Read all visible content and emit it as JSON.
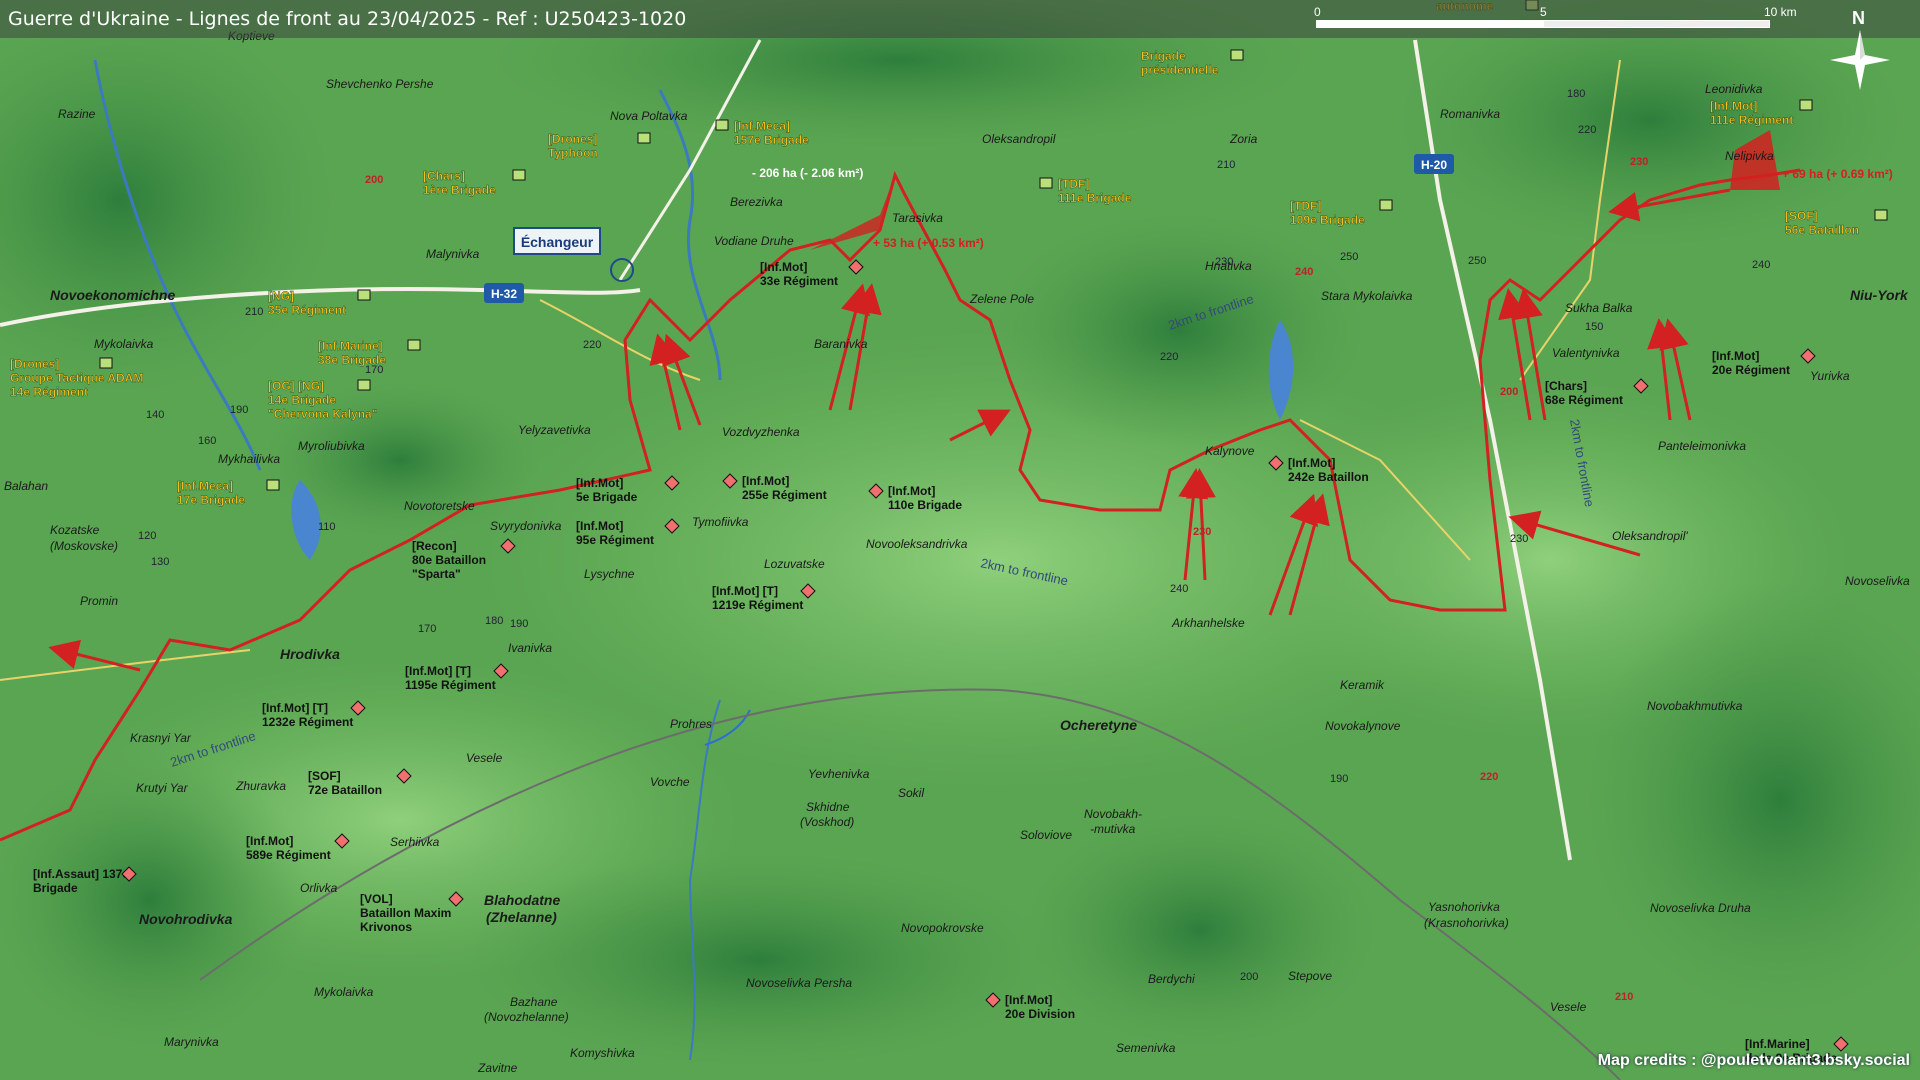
{
  "title": "Guerre d'Ukraine - Lignes de front au 23/04/2025 - Ref : U250423-1020",
  "scale": {
    "zero": "0",
    "five": "5",
    "ten": "10 km"
  },
  "north": "N",
  "credits": "Map credits : @pouletvolant3.bsky.social",
  "colors": {
    "front": "#d32020",
    "unit_label": "#f0c020",
    "town_label": "#1a1a1a",
    "road_badge": "#1e5aa8"
  },
  "towns": [
    {
      "name": "Koptieve"
    },
    {
      "name": "Shevchenko Pershe"
    },
    {
      "name": "Razine"
    },
    {
      "name": "Nova Poltavka"
    },
    {
      "name": "Berezivka"
    },
    {
      "name": "Vodiane Druhe"
    },
    {
      "name": "Tarasivka"
    },
    {
      "name": "Oleksandropil"
    },
    {
      "name": "Zoria"
    },
    {
      "name": "Romanivka"
    },
    {
      "name": "Leonidivka"
    },
    {
      "name": "Nelipivka"
    },
    {
      "name": "Malynivka"
    },
    {
      "name": "Novoekonomichne"
    },
    {
      "name": "Mykolaivka"
    },
    {
      "name": "Hnativka"
    },
    {
      "name": "Stara Mykolaivka"
    },
    {
      "name": "Sukha Balka"
    },
    {
      "name": "Niu-York"
    },
    {
      "name": "Zelene Pole"
    },
    {
      "name": "Baranivka"
    },
    {
      "name": "Valentynivka"
    },
    {
      "name": "Yurivka"
    },
    {
      "name": "Yelyzavetivka"
    },
    {
      "name": "Vozdvyzhenka"
    },
    {
      "name": "Mykhailivka"
    },
    {
      "name": "Myroliubivka"
    },
    {
      "name": "Kalynove"
    },
    {
      "name": "Panteleimonivka"
    },
    {
      "name": "Balahan"
    },
    {
      "name": "Novotoretske"
    },
    {
      "name": "Svyrydonivka"
    },
    {
      "name": "Tymofiivka"
    },
    {
      "name": "Kozatske"
    },
    {
      "name": "(Moskovske)"
    },
    {
      "name": "Lozuvatske"
    },
    {
      "name": "Novooleksandrivka"
    },
    {
      "name": "Oleksandropil'"
    },
    {
      "name": "Lysychne"
    },
    {
      "name": "Promin"
    },
    {
      "name": "Arkhanhelske"
    },
    {
      "name": "Novoselivka"
    },
    {
      "name": "Hrodivka"
    },
    {
      "name": "Ivanivka"
    },
    {
      "name": "Keramik"
    },
    {
      "name": "Ocheretyne"
    },
    {
      "name": "Novobakhmutivka"
    },
    {
      "name": "Prohres"
    },
    {
      "name": "Novokalynove"
    },
    {
      "name": "Krasnyi Yar"
    },
    {
      "name": "Vesele"
    },
    {
      "name": "Krutyi Yar"
    },
    {
      "name": "Zhuravka"
    },
    {
      "name": "Vovche"
    },
    {
      "name": "Yevhenivka"
    },
    {
      "name": "Sokil"
    },
    {
      "name": "Skhidne"
    },
    {
      "name": "(Voskhod)"
    },
    {
      "name": "Soloviove"
    },
    {
      "name": "Novobakh-"
    },
    {
      "name": "-mutivka"
    },
    {
      "name": "Serhiivka"
    },
    {
      "name": "Orlivka"
    },
    {
      "name": "Blahodatne"
    },
    {
      "name": "(Zhelanne)"
    },
    {
      "name": "Novopokrovske"
    },
    {
      "name": "Yasnohorivka"
    },
    {
      "name": "(Krasnohorivka)"
    },
    {
      "name": "Novoselivka Druha"
    },
    {
      "name": "Novohrodivka"
    },
    {
      "name": "Berdychi"
    },
    {
      "name": "Stepove"
    },
    {
      "name": "Mykolaivka"
    },
    {
      "name": "Novoselivka Persha"
    },
    {
      "name": "Vesele"
    },
    {
      "name": "Bazhane"
    },
    {
      "name": "(Novozhelanne)"
    },
    {
      "name": "Marynivka"
    },
    {
      "name": "Komyshivka"
    },
    {
      "name": "Semenivka"
    },
    {
      "name": "Zavitne"
    }
  ],
  "units": [
    {
      "line1": "[Drones]",
      "line2": "Typhoon"
    },
    {
      "line1": "[Inf.Meca]",
      "line2": "157e Brigade"
    },
    {
      "line1": "Brigade",
      "line2": "présidentielle"
    },
    {
      "line1": "[Chars]",
      "line2": "1ère Brigade"
    },
    {
      "line1": "[TDF]",
      "line2": "111e Brigade"
    },
    {
      "line1": "[TDF]",
      "line2": "109e Brigade"
    },
    {
      "line1": "[NG]",
      "line2": "35e Régiment"
    },
    {
      "line1": "[Inf.Marine]",
      "line2": "38e Brigade"
    },
    {
      "line1": "[Drones]",
      "line2": "Groupe Tactique ADAM",
      "line3": "14e Régiment"
    },
    {
      "line1": "[OG] [NG]",
      "line2": "14e Brigade",
      "line3": "\"Chervona Kalyna\""
    },
    {
      "line1": "[Inf.Meca]",
      "line2": "17e Brigade"
    },
    {
      "line1": "[Inf.Mot]",
      "line2": "111e Régiment"
    },
    {
      "line1": "[SOF]",
      "line2": "56e Bataillon"
    },
    {
      "line1": "[Inf.Mot]",
      "line2": "33e Régiment"
    },
    {
      "line1": "[Chars]",
      "line2": "68e Régiment"
    },
    {
      "line1": "[Inf.Mot]",
      "line2": "20e Régiment"
    },
    {
      "line1": "[Inf.Mot]",
      "line2": "5e Brigade"
    },
    {
      "line1": "[Inf.Mot]",
      "line2": "255e Régiment"
    },
    {
      "line1": "[Inf.Mot]",
      "line2": "110e Brigade"
    },
    {
      "line1": "[Inf.Mot]",
      "line2": "242e Bataillon"
    },
    {
      "line1": "[Inf.Mot]",
      "line2": "95e Régiment"
    },
    {
      "line1": "[Recon]",
      "line2": "80e Bataillon",
      "line3": "\"Sparta\""
    },
    {
      "line1": "[Inf.Mot] [T]",
      "line2": "1219e Régiment"
    },
    {
      "line1": "[Inf.Mot] [T]",
      "line2": "1195e Régiment"
    },
    {
      "line1": "[Inf.Mot] [T]",
      "line2": "1232e Régiment"
    },
    {
      "line1": "[SOF]",
      "line2": "72e Bataillon"
    },
    {
      "line1": "[Inf.Mot]",
      "line2": "589e Régiment"
    },
    {
      "line1": "[Inf.Assaut] 137e",
      "line2": "Brigade"
    },
    {
      "line1": "[VOL]",
      "line2": "Bataillon Maxim",
      "line3": "Krivonos"
    },
    {
      "line1": "[Inf.Mot]",
      "line2": "20e Division"
    },
    {
      "line1": "[Inf.Marine]",
      "line2": "de la 9e Brigade"
    },
    {
      "line1": "autonome",
      "line2": ""
    }
  ],
  "annotations": {
    "loss": "- 206 ha (- 2.06 km²)",
    "gain1": "+ 53 ha (+ 0.53 km²)",
    "gain2": "+ 69 ha (+ 0.69 km²)",
    "interchange": "Échangeur",
    "frontline_2km": "2km to frontline"
  },
  "roads": [
    "H-32",
    "H-20"
  ],
  "elevations": [
    "200",
    "210",
    "170",
    "190",
    "160",
    "140",
    "120",
    "130",
    "110",
    "150",
    "180",
    "220",
    "230",
    "240",
    "250",
    "200",
    "210",
    "220",
    "230",
    "240",
    "230",
    "220",
    "190",
    "200",
    "210",
    "220",
    "230",
    "240",
    "250",
    "170",
    "180",
    "190"
  ]
}
